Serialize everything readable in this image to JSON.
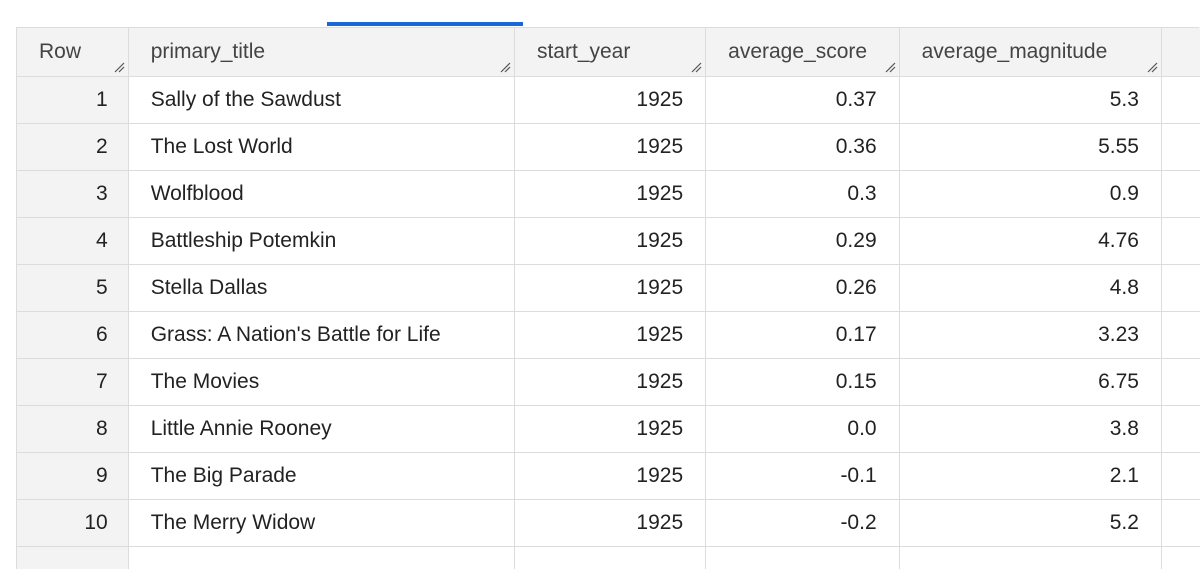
{
  "table": {
    "columns": [
      {
        "key": "row",
        "label": "Row"
      },
      {
        "key": "primary_title",
        "label": "primary_title"
      },
      {
        "key": "start_year",
        "label": "start_year"
      },
      {
        "key": "average_score",
        "label": "average_score"
      },
      {
        "key": "average_magnitude",
        "label": "average_magnitude"
      }
    ],
    "rows": [
      {
        "row": "1",
        "primary_title": "Sally of the Sawdust",
        "start_year": "1925",
        "average_score": "0.37",
        "average_magnitude": "5.3"
      },
      {
        "row": "2",
        "primary_title": "The Lost World",
        "start_year": "1925",
        "average_score": "0.36",
        "average_magnitude": "5.55"
      },
      {
        "row": "3",
        "primary_title": "Wolfblood",
        "start_year": "1925",
        "average_score": "0.3",
        "average_magnitude": "0.9"
      },
      {
        "row": "4",
        "primary_title": "Battleship Potemkin",
        "start_year": "1925",
        "average_score": "0.29",
        "average_magnitude": "4.76"
      },
      {
        "row": "5",
        "primary_title": "Stella Dallas",
        "start_year": "1925",
        "average_score": "0.26",
        "average_magnitude": "4.8"
      },
      {
        "row": "6",
        "primary_title": "Grass: A Nation's Battle for Life",
        "start_year": "1925",
        "average_score": "0.17",
        "average_magnitude": "3.23"
      },
      {
        "row": "7",
        "primary_title": "The Movies",
        "start_year": "1925",
        "average_score": "0.15",
        "average_magnitude": "6.75"
      },
      {
        "row": "8",
        "primary_title": "Little Annie Rooney",
        "start_year": "1925",
        "average_score": "0.0",
        "average_magnitude": "3.8"
      },
      {
        "row": "9",
        "primary_title": "The Big Parade",
        "start_year": "1925",
        "average_score": "-0.1",
        "average_magnitude": "2.1"
      },
      {
        "row": "10",
        "primary_title": "The Merry Widow",
        "start_year": "1925",
        "average_score": "-0.2",
        "average_magnitude": "5.2"
      }
    ]
  },
  "icons": {
    "resize_handle": "column-resize-handle-icon"
  },
  "colors": {
    "active_tab_indicator": "#1a66d9",
    "header_background": "#f3f3f3",
    "grid_line": "#dcdcdc"
  }
}
